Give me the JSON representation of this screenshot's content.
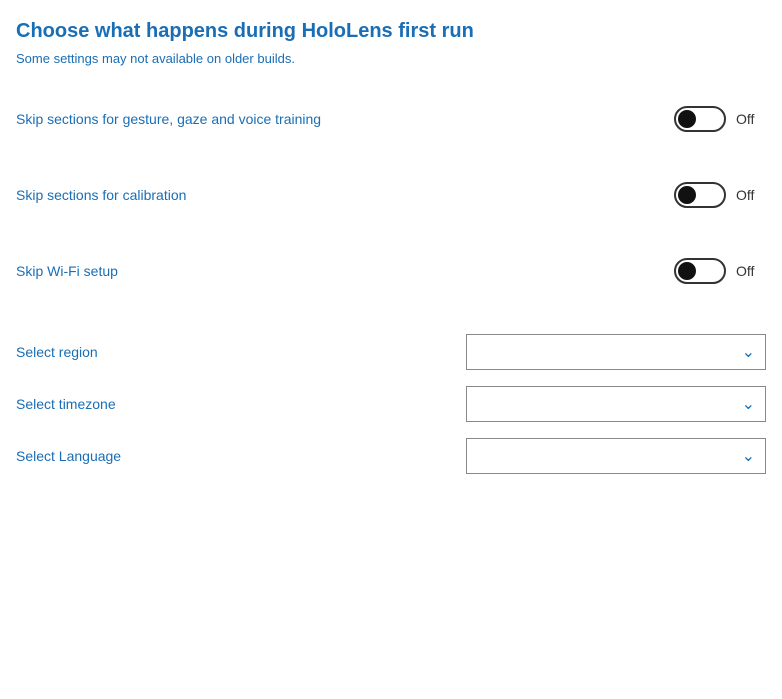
{
  "header": {
    "title": "Choose what happens during HoloLens first run",
    "subtitle": "Some settings may not available on older builds."
  },
  "toggles": [
    {
      "id": "gesture-training",
      "label": "Skip sections for gesture, gaze and voice training",
      "status": "Off",
      "enabled": false
    },
    {
      "id": "calibration",
      "label": "Skip sections for calibration",
      "status": "Off",
      "enabled": false
    },
    {
      "id": "wifi-setup",
      "label": "Skip Wi-Fi setup",
      "status": "Off",
      "enabled": false
    }
  ],
  "dropdowns": [
    {
      "id": "region",
      "label": "Select region",
      "placeholder": "",
      "arrow": "∨"
    },
    {
      "id": "timezone",
      "label": "Select timezone",
      "placeholder": "",
      "arrow": "∨"
    },
    {
      "id": "language",
      "label": "Select Language",
      "placeholder": "",
      "arrow": "∨"
    }
  ]
}
